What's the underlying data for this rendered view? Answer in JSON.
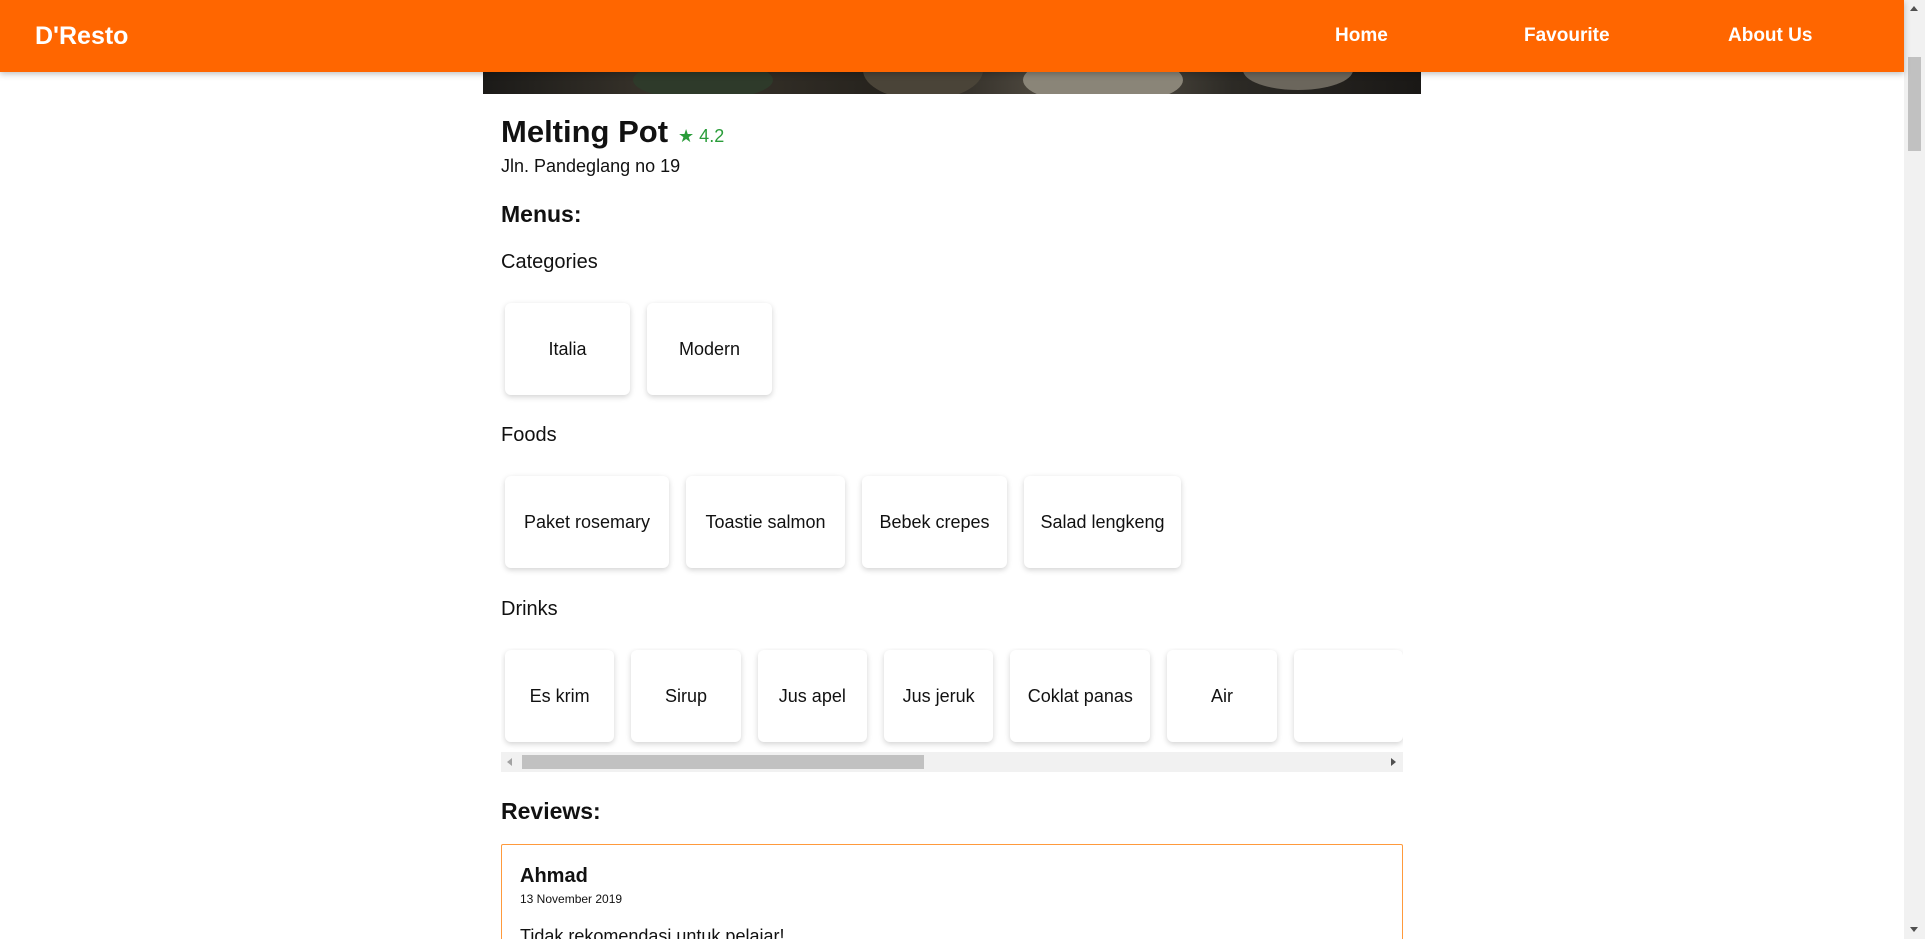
{
  "brand": "D'Resto",
  "nav": {
    "home": "Home",
    "favourite": "Favourite",
    "about": "About Us"
  },
  "restaurant": {
    "name": "Melting Pot",
    "rating": "★ 4.2",
    "address": "Jln. Pandeglang no 19"
  },
  "menus_heading": "Menus:",
  "categories": {
    "heading": "Categories",
    "items": [
      "Italia",
      "Modern"
    ]
  },
  "foods": {
    "heading": "Foods",
    "items": [
      "Paket rosemary",
      "Toastie salmon",
      "Bebek crepes",
      "Salad lengkeng"
    ]
  },
  "drinks": {
    "heading": "Drinks",
    "items": [
      "Es krim",
      "Sirup",
      "Jus apel",
      "Jus jeruk",
      "Coklat panas",
      "Air"
    ]
  },
  "reviews": {
    "heading": "Reviews:",
    "items": [
      {
        "name": "Ahmad",
        "date": "13 November 2019",
        "text": "Tidak rekomendasi untuk pelajar!"
      }
    ]
  },
  "colors": {
    "accent": "#ff6600",
    "rating": "#2a9d3a",
    "review_border": "#ff9a3c"
  }
}
